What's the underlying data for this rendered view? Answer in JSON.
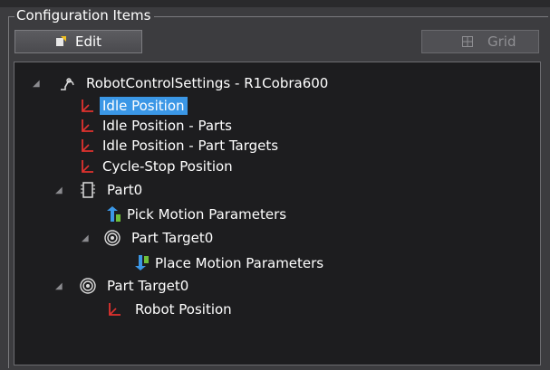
{
  "group": {
    "title": "Configuration Items"
  },
  "toolbar": {
    "edit_label": "Edit",
    "grid_label": "Grid"
  },
  "tree": {
    "root": {
      "label": "RobotControlSettings - R1Cobra600"
    },
    "idle_position": {
      "label": "Idle Position",
      "selected": true
    },
    "idle_position_parts": {
      "label": "Idle Position - Parts"
    },
    "idle_position_part_targets": {
      "label": "Idle Position - Part Targets"
    },
    "cycle_stop_position": {
      "label": "Cycle-Stop Position"
    },
    "part0": {
      "label": "Part0"
    },
    "pick_motion_parameters": {
      "label": "Pick Motion Parameters"
    },
    "part_target0_child": {
      "label": "Part Target0"
    },
    "place_motion_parameters": {
      "label": "Place Motion Parameters"
    },
    "part_target0": {
      "label": "Part Target0"
    },
    "robot_position": {
      "label": "Robot Position"
    }
  },
  "colors": {
    "background": "#3c3c3f",
    "tree_background": "#1d1d1f",
    "selection": "#3b97e6",
    "position_icon": "#e0322f"
  },
  "icons": {
    "edit": "edit-icon",
    "grid": "grid-icon",
    "robot": "robot-arm-icon",
    "position": "position-axes-icon",
    "part": "part-chip-icon",
    "target": "target-icon",
    "pick": "pick-motion-icon",
    "place": "place-motion-icon",
    "expander": "expand-triangle-icon"
  }
}
